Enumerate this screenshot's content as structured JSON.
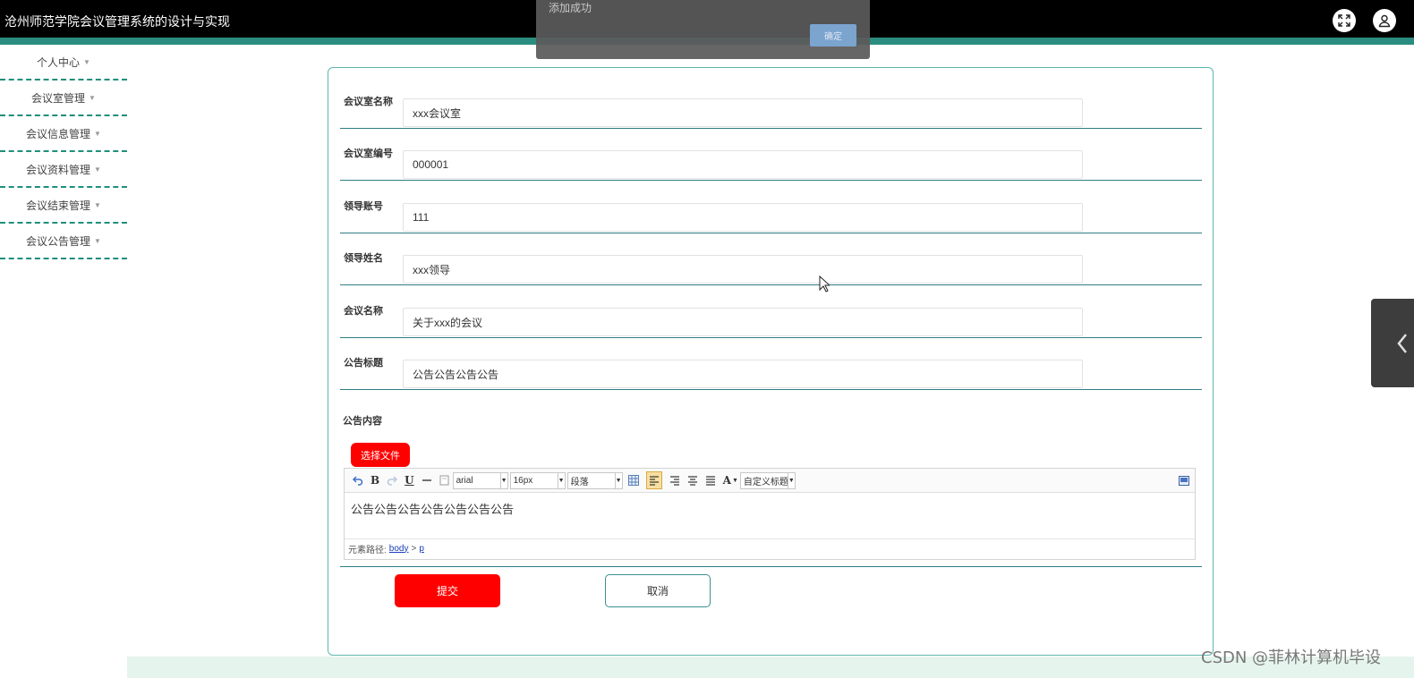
{
  "header": {
    "title": "沧州师范学院会议管理系统的设计与实现",
    "icons": [
      "fullscreen-icon",
      "user-icon"
    ]
  },
  "sidebar": {
    "items": [
      {
        "label": "个人中心"
      },
      {
        "label": "会议室管理"
      },
      {
        "label": "会议信息管理"
      },
      {
        "label": "会议资料管理"
      },
      {
        "label": "会议结束管理"
      },
      {
        "label": "会议公告管理"
      }
    ]
  },
  "form": {
    "fields": [
      {
        "label": "会议室名称",
        "value": "xxx会议室"
      },
      {
        "label": "会议室编号",
        "value": "000001"
      },
      {
        "label": "领导账号",
        "value": "111"
      },
      {
        "label": "领导姓名",
        "value": "xxx领导"
      },
      {
        "label": "会议名称",
        "value": "关于xxx的会议"
      },
      {
        "label": "公告标题",
        "value": "公告公告公告公告"
      }
    ],
    "content_label": "公告内容",
    "file_button": "选择文件",
    "editor": {
      "font": "arial",
      "size": "16px",
      "paragraph": "段落",
      "custom_heading": "自定义标题",
      "text_color_glyph": "A",
      "content": "公告公告公告公告公告公告公告",
      "path_label": "元素路径:",
      "path_body": "body",
      "path_sep": ">",
      "path_p": "p"
    },
    "submit_label": "提交",
    "cancel_label": "取消"
  },
  "dialog": {
    "message": "添加成功",
    "ok_label": "确定"
  },
  "watermark": "CSDN @菲林计算机毕设",
  "colors": {
    "accent": "#2a8d7f",
    "primary_button": "#ff0000",
    "header_bg": "#000000"
  }
}
